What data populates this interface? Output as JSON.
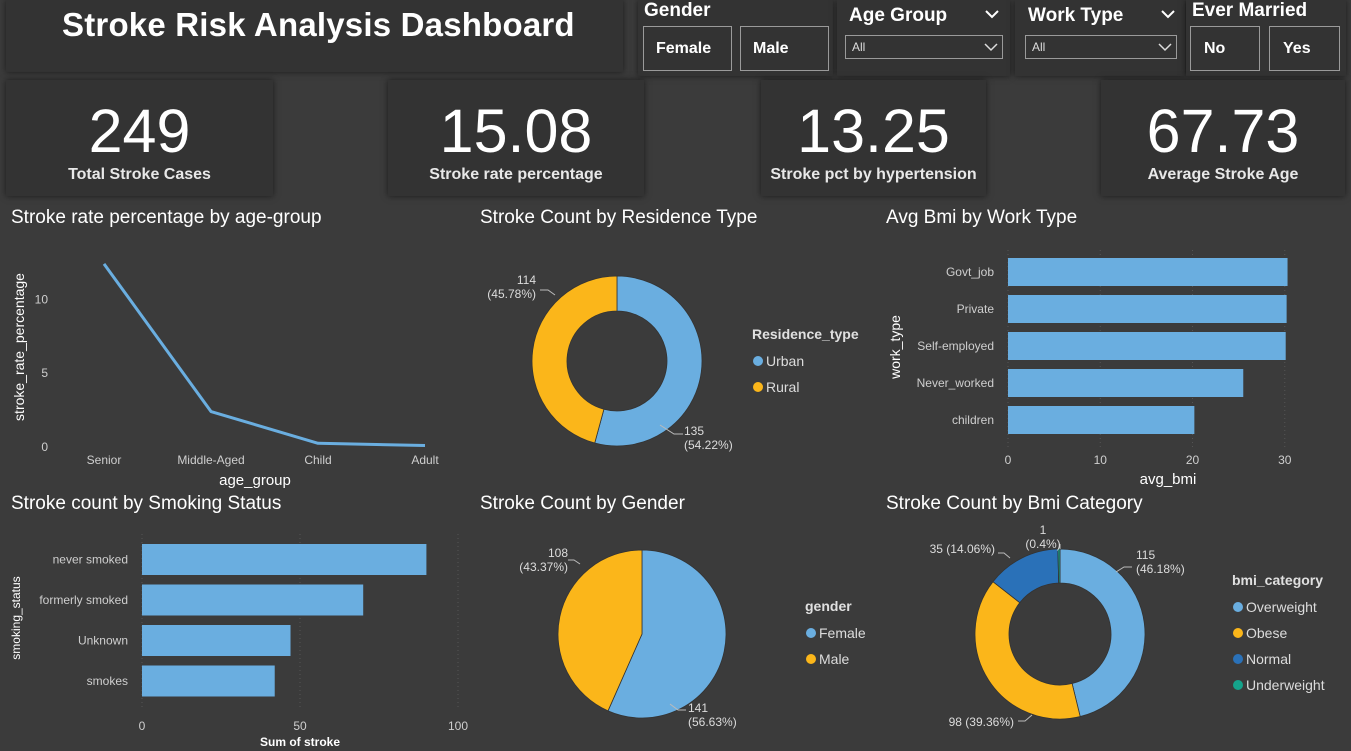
{
  "title": "Stroke Risk Analysis Dashboard",
  "slicers": {
    "gender": {
      "title": "Gender",
      "options": [
        "Female",
        "Male"
      ]
    },
    "age_group": {
      "title": "Age Group",
      "selected": "All"
    },
    "work_type": {
      "title": "Work Type",
      "selected": "All"
    },
    "ever_married": {
      "title": "Ever Married",
      "options": [
        "No",
        "Yes"
      ]
    }
  },
  "kpis": [
    {
      "value": "249",
      "label": "Total Stroke Cases"
    },
    {
      "value": "15.08",
      "label": "Stroke rate percentage"
    },
    {
      "value": "13.25",
      "label": "Stroke pct by hypertension"
    },
    {
      "value": "67.73",
      "label": "Average Stroke Age"
    }
  ],
  "colors": {
    "blue": "#6aaee0",
    "yellow": "#fbb61a",
    "dark_blue": "#2a71b8",
    "teal": "#14a38b",
    "background": "#3b3b3b",
    "card": "#333333"
  },
  "chart_data": [
    {
      "id": "age_line",
      "type": "line",
      "title": "Stroke rate percentage by age-group",
      "xlabel": "age_group",
      "ylabel": "stroke_rate_percentage",
      "categories": [
        "Senior",
        "Middle-Aged",
        "Child",
        "Adult"
      ],
      "values": [
        12.4,
        2.4,
        0.25,
        0.1
      ],
      "ylim": [
        0,
        13
      ],
      "yticks": [
        0,
        5,
        10
      ]
    },
    {
      "id": "residence_donut",
      "type": "pie",
      "title": "Stroke Count by Residence Type",
      "legend_title": "Residence_type",
      "slices": [
        {
          "name": "Urban",
          "value": 135,
          "pct": "54.22%"
        },
        {
          "name": "Rural",
          "value": 114,
          "pct": "45.78%"
        }
      ]
    },
    {
      "id": "bmi_work_bar",
      "type": "bar",
      "title": "Avg Bmi by Work Type",
      "xlabel": "avg_bmi",
      "ylabel": "work_type",
      "categories": [
        "Govt_job",
        "Private",
        "Self-employed",
        "Never_worked",
        "children"
      ],
      "values": [
        30.3,
        30.2,
        30.1,
        25.5,
        20.2
      ],
      "xlim": [
        0,
        31
      ],
      "xticks": [
        0,
        10,
        20,
        30
      ]
    },
    {
      "id": "smoking_bar",
      "type": "bar",
      "title": "Stroke count by Smoking Status",
      "xlabel": "Sum of stroke",
      "ylabel": "smoking_status",
      "categories": [
        "never smoked",
        "formerly smoked",
        "Unknown",
        "smokes"
      ],
      "values": [
        90,
        70,
        47,
        42
      ],
      "xlim": [
        0,
        100
      ],
      "xticks": [
        0,
        50,
        100
      ]
    },
    {
      "id": "gender_pie",
      "type": "pie",
      "title": "Stroke Count by Gender",
      "legend_title": "gender",
      "slices": [
        {
          "name": "Female",
          "value": 141,
          "pct": "56.63%"
        },
        {
          "name": "Male",
          "value": 108,
          "pct": "43.37%"
        }
      ]
    },
    {
      "id": "bmi_cat_donut",
      "type": "pie",
      "title": "Stroke Count by Bmi Category",
      "legend_title": "bmi_category",
      "slices": [
        {
          "name": "Overweight",
          "value": 115,
          "pct": "46.18%"
        },
        {
          "name": "Obese",
          "value": 98,
          "pct": "39.36%"
        },
        {
          "name": "Normal",
          "value": 35,
          "pct": "14.06%"
        },
        {
          "name": "Underweight",
          "value": 1,
          "pct": "0.4%"
        }
      ]
    }
  ]
}
